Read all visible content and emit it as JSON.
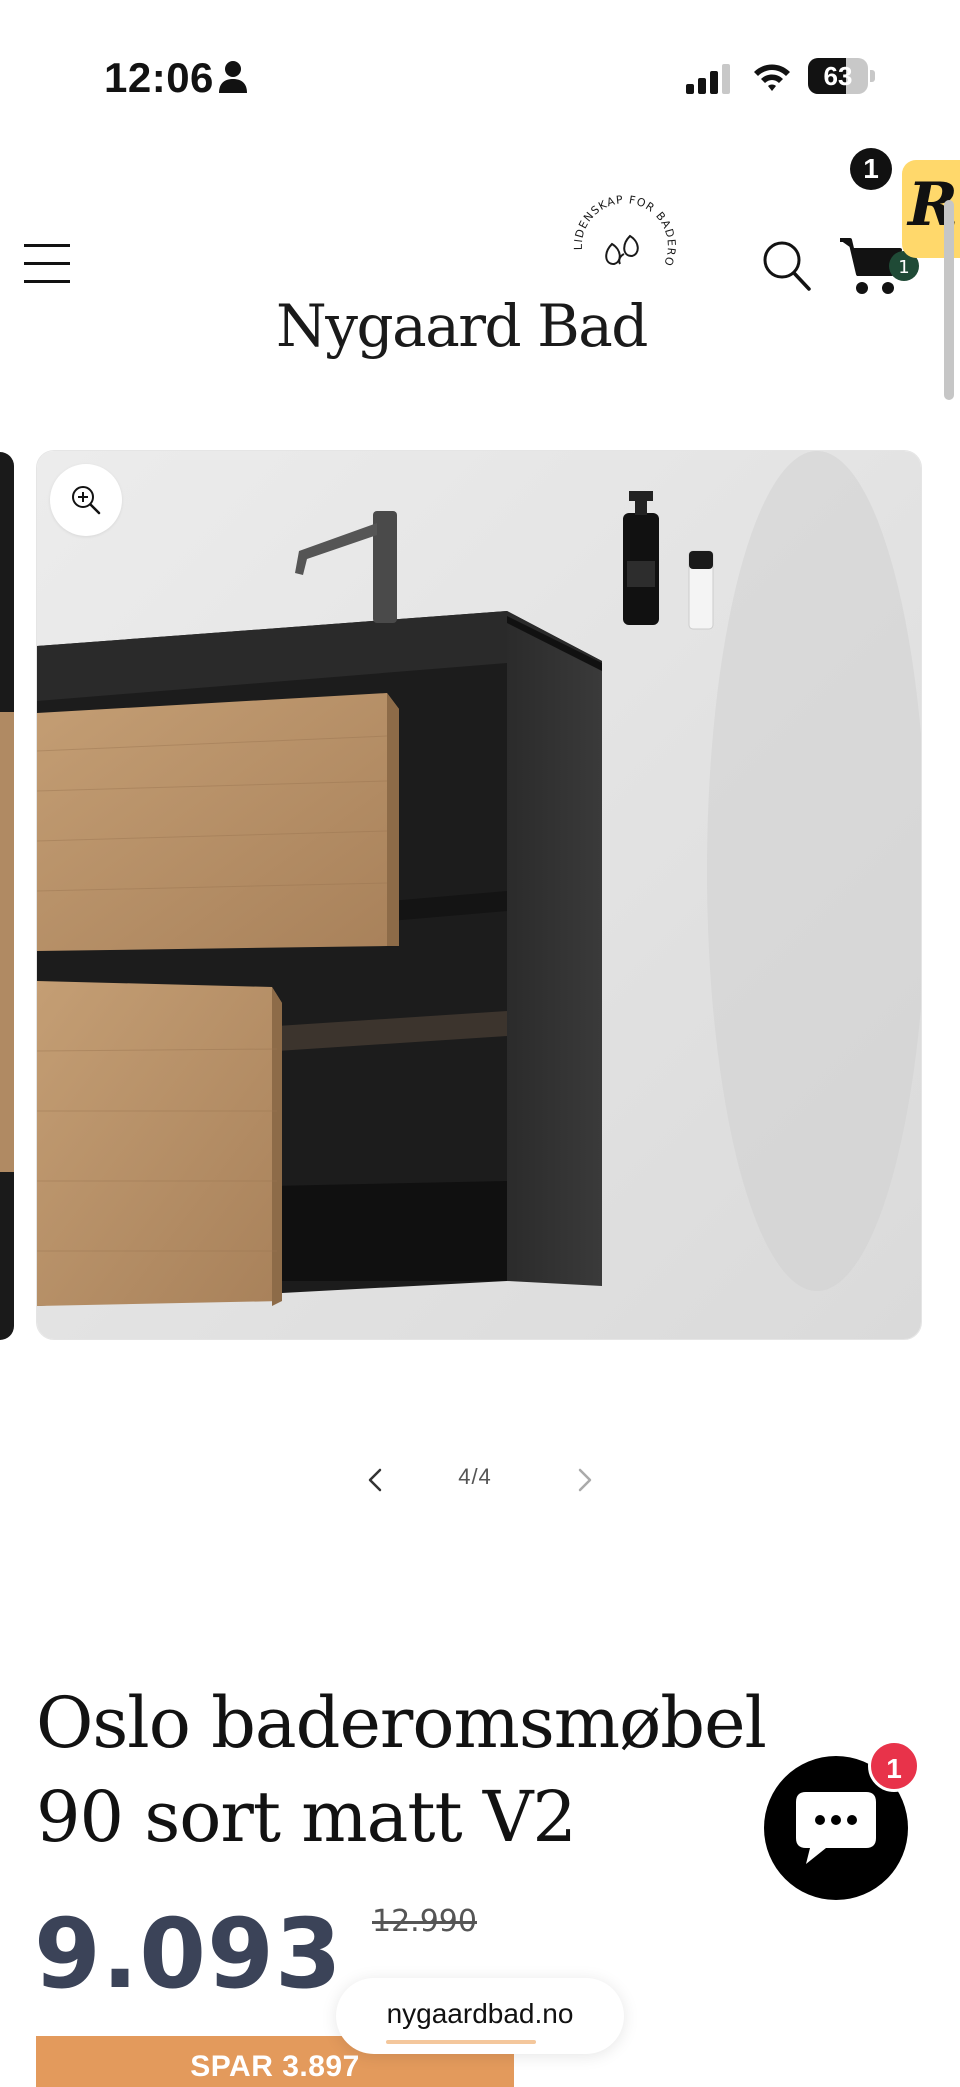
{
  "status_bar": {
    "time": "12:06",
    "battery_percent": "63",
    "battery_level": 0.63
  },
  "header": {
    "logo_text": "Nygaard Bad",
    "logo_tagline": "LIDENSKAP FOR BADEROM",
    "cart_count": "1",
    "reviews_badge_count": "1"
  },
  "gallery": {
    "pager_text": "4/4",
    "current_slide": 4,
    "total_slides": 4
  },
  "product": {
    "title": "Oslo baderomsmøbel 90 sort matt V2",
    "price": "9.093",
    "old_price": "12.990",
    "save_label": "SPAR 3.897"
  },
  "chat": {
    "unread_count": "1"
  },
  "browser": {
    "url": "nygaardbad.no"
  },
  "colors": {
    "price_text": "#3b4358",
    "save_banner": "#e39a5c",
    "cart_badge": "#1f4a36",
    "chat_badge": "#e8334a",
    "reviews_badge_bg": "#ffd86b"
  },
  "icons": [
    "person-icon",
    "signal-icon",
    "wifi-icon",
    "menu-icon",
    "search-icon",
    "cart-icon",
    "zoom-icon",
    "chevron-left-icon",
    "chevron-right-icon",
    "chat-icon"
  ]
}
